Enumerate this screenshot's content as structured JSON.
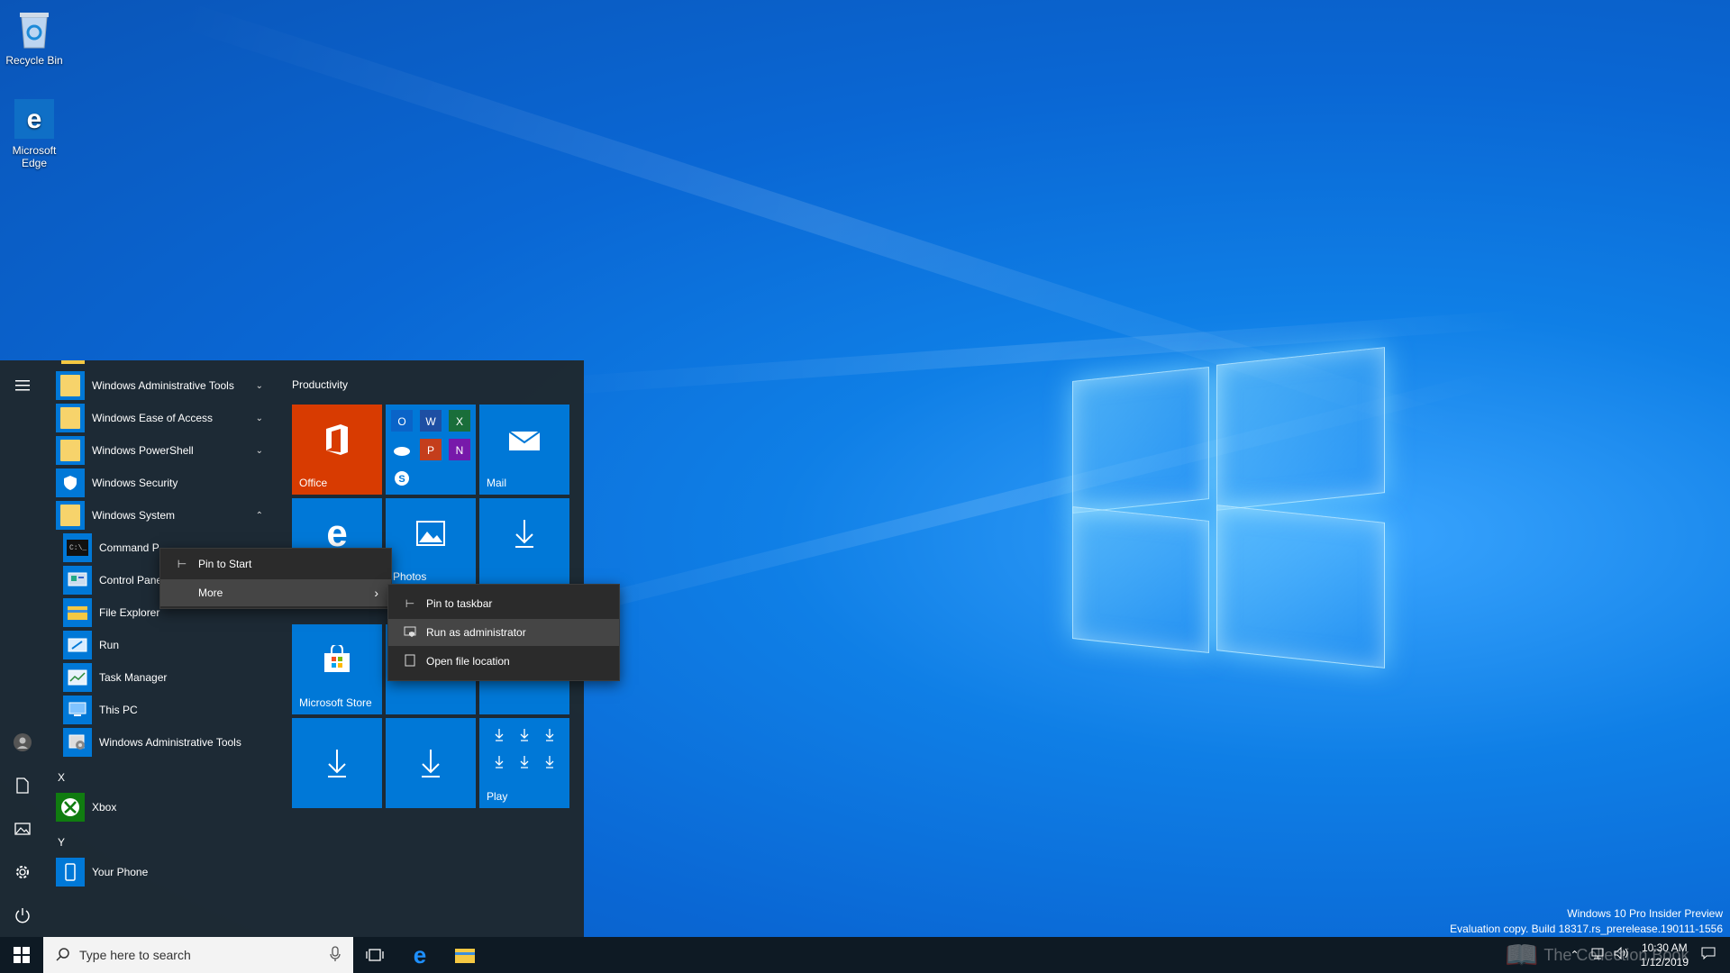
{
  "desktop": {
    "icons": [
      {
        "label": "Recycle Bin",
        "icon": "recycle-bin-icon"
      },
      {
        "label": "Microsoft Edge",
        "icon": "edge-icon"
      }
    ],
    "watermark": {
      "line1": "Windows 10 Pro Insider Preview",
      "line2": "Evaluation copy. Build 18317.rs_prerelease.190111-1556"
    },
    "overlay_text": "The Collection Book"
  },
  "start_menu": {
    "rail": [
      {
        "icon": "hamburger-icon"
      },
      {
        "icon": "user-avatar-icon"
      },
      {
        "icon": "documents-icon"
      },
      {
        "icon": "pictures-icon"
      },
      {
        "icon": "settings-gear-icon"
      },
      {
        "icon": "power-icon"
      }
    ],
    "apps": {
      "admin_tools": "Windows Administrative Tools",
      "ease_access": "Windows Ease of Access",
      "powershell": "Windows PowerShell",
      "security": "Windows Security",
      "system": "Windows System",
      "cmd": "Command P",
      "control": "Control Pane",
      "explorer": "File Explorer",
      "run": "Run",
      "taskmgr": "Task Manager",
      "thispc": "This PC",
      "admin_tools2": "Windows Administrative Tools",
      "letter_x": "X",
      "xbox": "Xbox",
      "letter_y": "Y",
      "yourphone": "Your Phone"
    },
    "tiles": {
      "group": "Productivity",
      "office": "Office",
      "mail": "Mail",
      "photos": "Photos",
      "store": "Microsoft Store",
      "play": "Play"
    },
    "colors": {
      "accent": "#0078d7",
      "office": "#d83b01"
    }
  },
  "context_menu": {
    "items": {
      "pin_start": "Pin to Start",
      "more": "More"
    }
  },
  "submenu": {
    "items": {
      "pin_taskbar": "Pin to taskbar",
      "run_admin": "Run as administrator",
      "open_location": "Open file location"
    }
  },
  "taskbar": {
    "search_placeholder": "Type here to search",
    "time": "10:30 AM",
    "date": "1/12/2019"
  }
}
